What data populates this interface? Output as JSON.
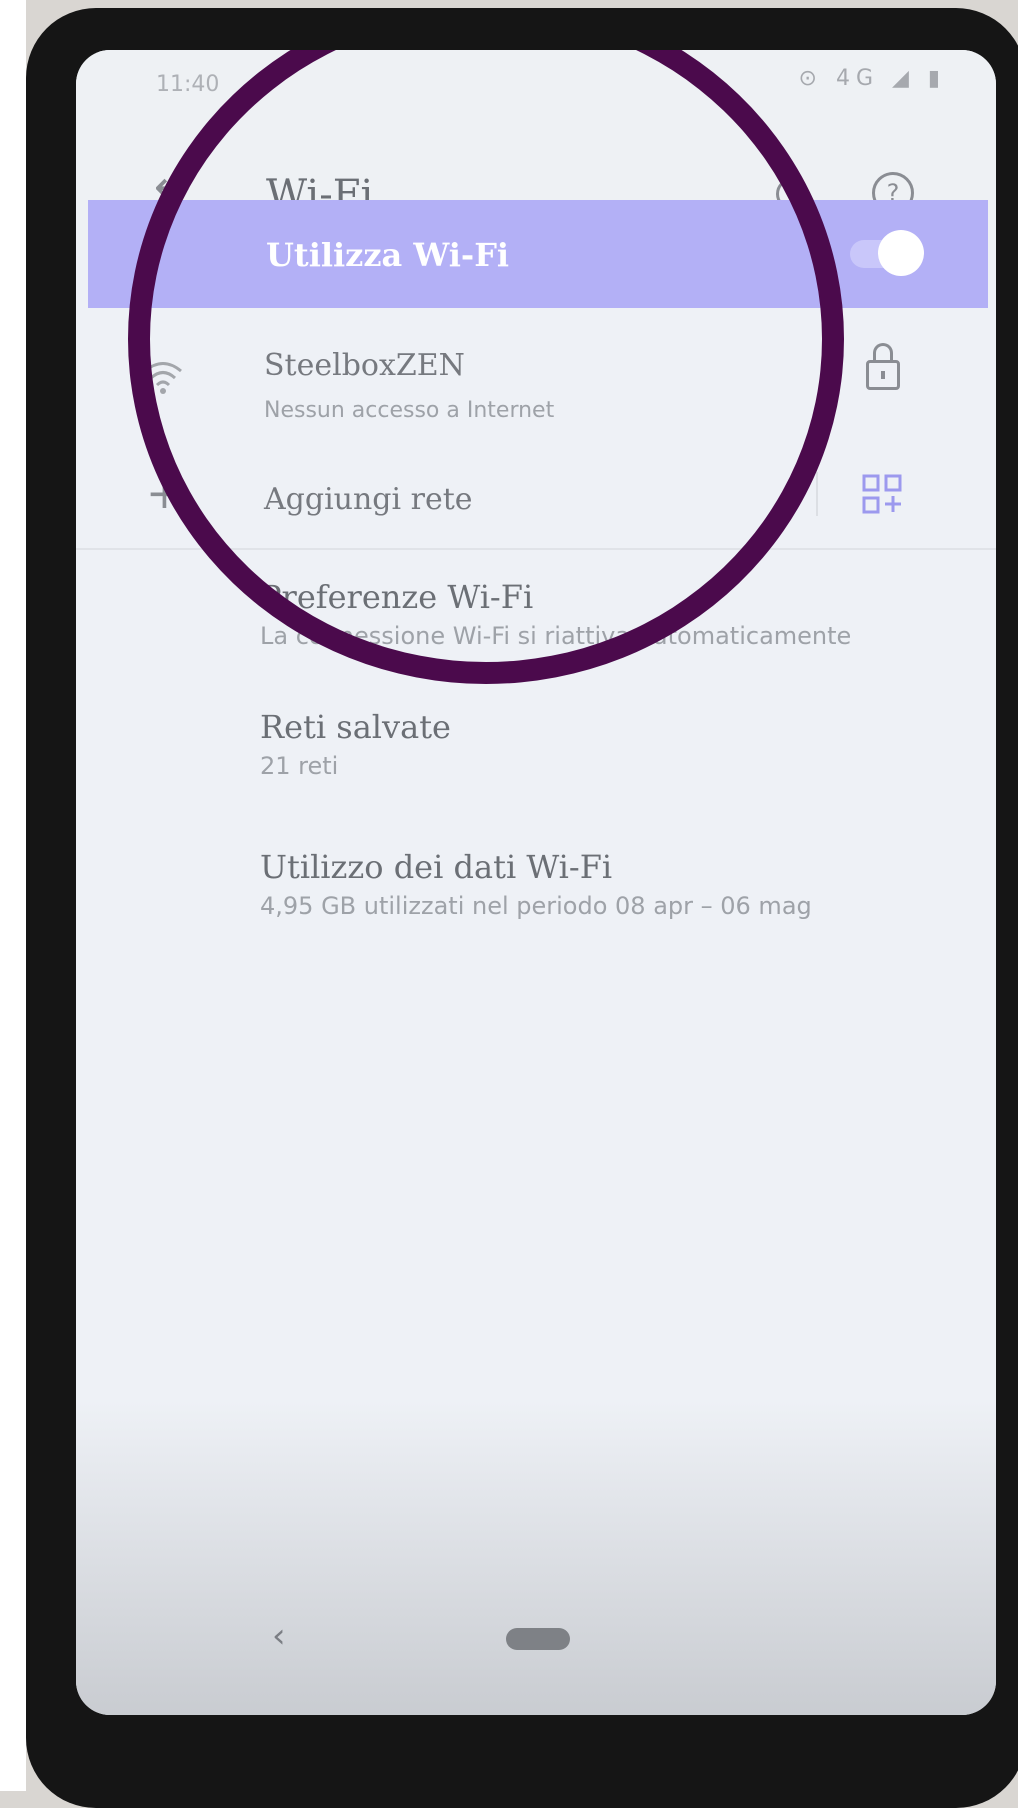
{
  "status_bar": {
    "time": "11:40",
    "icons": "⊙ 4G ◢ ▮"
  },
  "app_bar": {
    "title": "Wi-Fi",
    "back_icon": "arrow-left",
    "search_icon": "search",
    "help_icon": "help-circle",
    "help_glyph": "?"
  },
  "wifi_toggle": {
    "label": "Utilizza Wi-Fi",
    "enabled": true,
    "accent": "#b3b0f6"
  },
  "connected_network": {
    "name": "SteelboxZEN",
    "status": "Nessun accesso a Internet",
    "secured": true
  },
  "add_network": {
    "label": "Aggiungi rete",
    "plus_glyph": "+"
  },
  "settings": [
    {
      "title": "Preferenze Wi-Fi",
      "subtitle": "La connessione Wi-Fi si riattiva automaticamente"
    },
    {
      "title": "Reti salvate",
      "subtitle": "21 reti"
    },
    {
      "title": "Utilizzo dei dati Wi-Fi",
      "subtitle": "4,95 GB utilizzati nel periodo 08 apr – 06 mag"
    }
  ],
  "nav_bar": {
    "back_glyph": "‹"
  },
  "annotation": {
    "color": "#4b0a4c"
  }
}
